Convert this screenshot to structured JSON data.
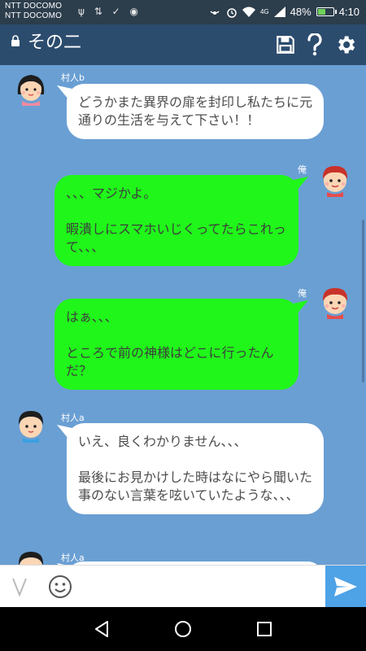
{
  "status_bar": {
    "carrier_1": "NTT DOCOMO",
    "carrier_2": "NTT DOCOMO",
    "left_icons": "ψ ⇅ ✓ ◉",
    "network": "4G",
    "battery_text": "48%",
    "battery_level": 0.48,
    "time": "4:10"
  },
  "app_bar": {
    "title": "その二",
    "actions": [
      "save-icon",
      "help-icon",
      "settings-icon"
    ]
  },
  "messages": [
    {
      "sender": "村人b",
      "side": "left",
      "text": "どうかまた異界の扉を封印し私たちに元通りの生活を与えて下さい！！"
    },
    {
      "sender": "俺",
      "side": "right",
      "text": "、、、マジかよ。\n\n暇潰しにスマホいじくってたらこれって、、、"
    },
    {
      "sender": "俺",
      "side": "right",
      "text": "はぁ、、、\n\nところで前の神様はどこに行ったんだ？"
    },
    {
      "sender": "村人a",
      "side": "left",
      "text": "いえ、良くわかりません、、、\n\n最後にお見かけした時はなにやら聞いた事のない言葉を呟いていたような、、、"
    },
    {
      "sender": "村人a",
      "side": "left",
      "text": ""
    }
  ],
  "input": {
    "placeholder": "",
    "value": ""
  },
  "colors": {
    "app_bar": "#2c4c6e",
    "chat_bg": "#6a9fd3",
    "my_bubble": "#20f61a",
    "their_bubble": "#ffffff",
    "send_button": "#4ea2e6"
  }
}
